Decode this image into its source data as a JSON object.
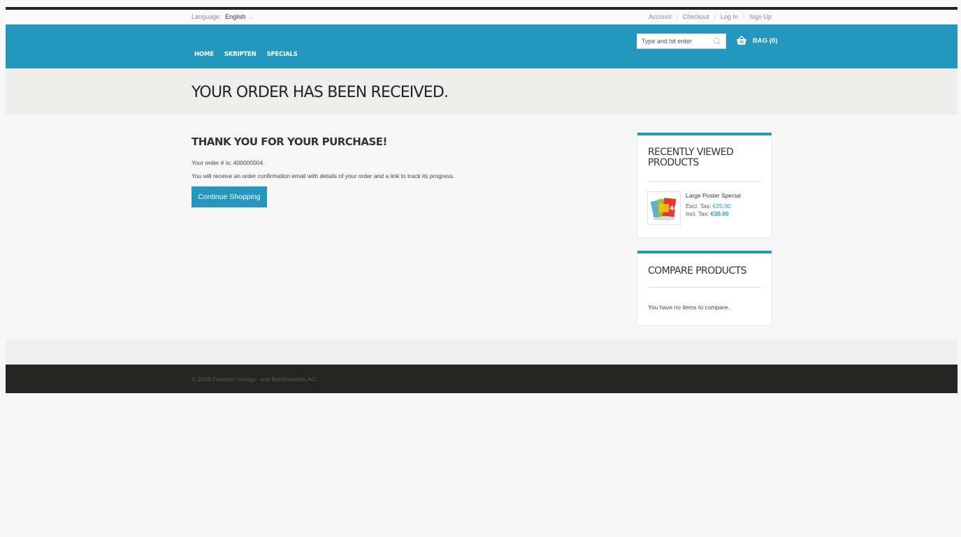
{
  "topbar": {
    "language_label": "Language:",
    "language_value": "English",
    "links": [
      "Account",
      "Checkout",
      "Log In",
      "Sign Up"
    ]
  },
  "header": {
    "nav": [
      "HOME",
      "SKRIPTEN",
      "SPECIALS"
    ],
    "search_placeholder": "Type and hit enter",
    "bag_label": "BAG (0)",
    "accent_color": "#2497bf"
  },
  "page": {
    "title": "YOUR ORDER HAS BEEN RECEIVED.",
    "thanks_heading": "THANK YOU FOR YOUR PURCHASE!",
    "order_prefix": "Your order # is: ",
    "order_number": "400000004.",
    "confirmation_text": "You will receive an order confirmation email with details of your order and a link to track its progress.",
    "continue_button": "Continue Shopping"
  },
  "sidebar": {
    "recently_viewed": {
      "title": "RECENTLY VIEWED PRODUCTS",
      "product": {
        "name": "Large Poster Special",
        "excl_label": "Excl. Tax: ",
        "excl_price": "€25.00",
        "incl_label": "Incl. Tax: ",
        "incl_price": "€30.00"
      }
    },
    "compare": {
      "title": "COMPARE PRODUCTS",
      "empty_text": "You have no items to compare."
    }
  },
  "footer": {
    "copyright": "© 2016 Facultas Verlags- und Buchhandels AG."
  }
}
